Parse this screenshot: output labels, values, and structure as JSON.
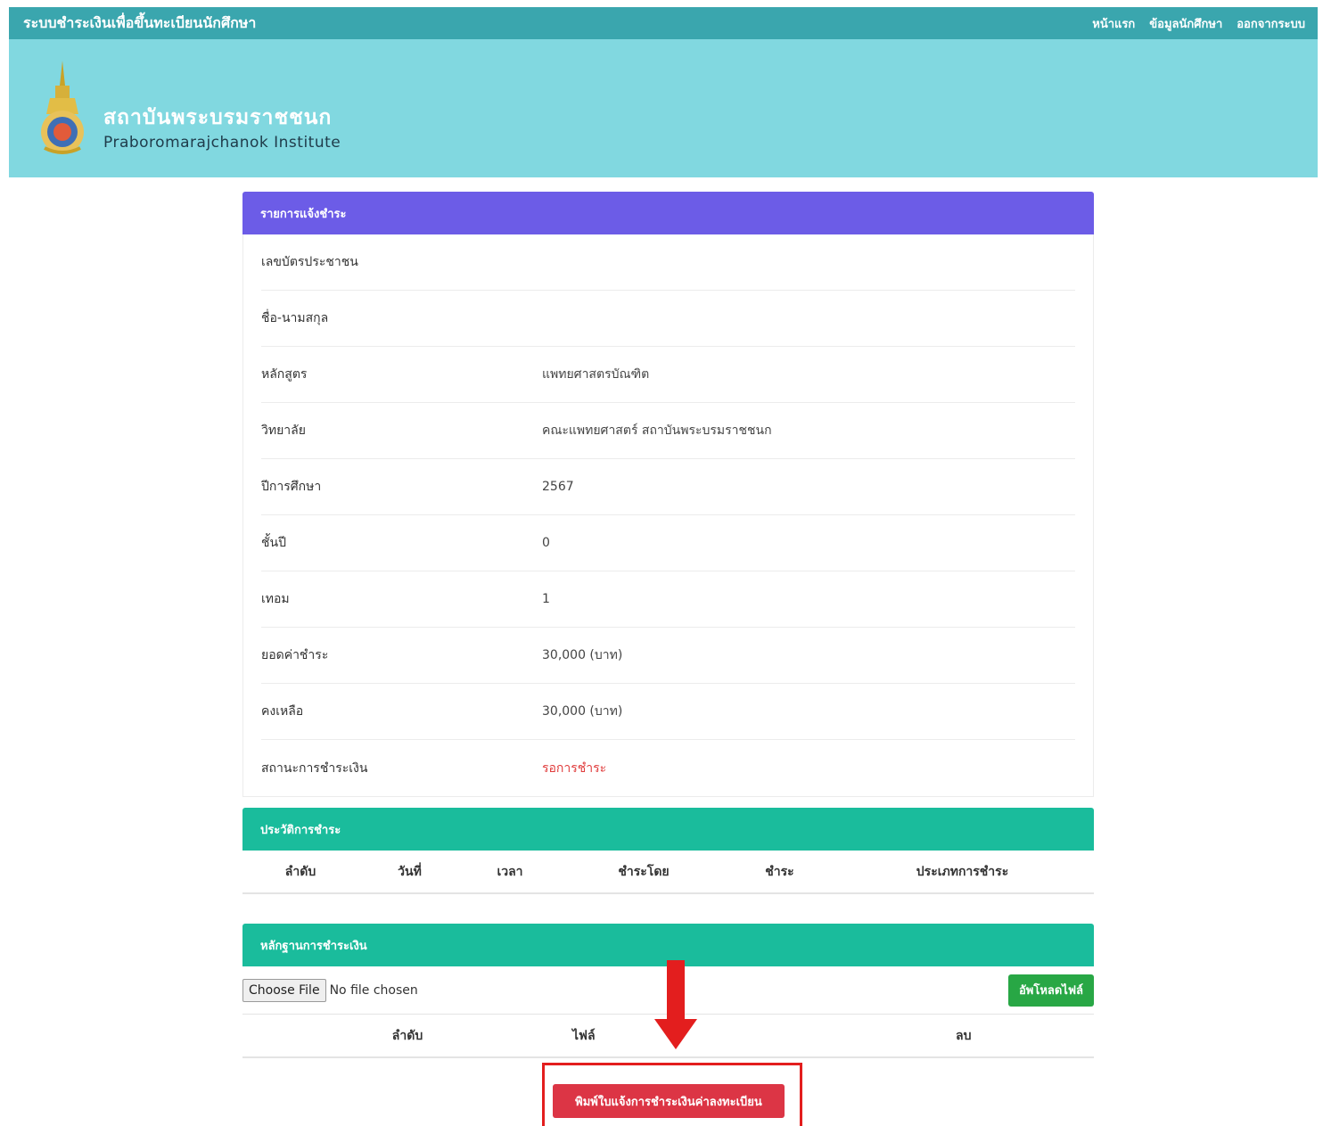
{
  "header": {
    "system_title": "ระบบชำระเงินเพื่อขึ้นทะเบียนนักศึกษา",
    "nav": [
      "หน้าแรก",
      "ข้อมูลนักศึกษา",
      "ออกจากระบบ"
    ]
  },
  "banner": {
    "institute_th": "สถาบันพระบรมราชชนก",
    "institute_en": "Praboromarajchanok Institute"
  },
  "payment_info": {
    "title": "รายการแจ้งชำระ",
    "rows": [
      {
        "label": "เลขบัตรประชาชน",
        "value": ""
      },
      {
        "label": "ชื่อ-นามสกุล",
        "value": ""
      },
      {
        "label": "หลักสูตร",
        "value": "แพทยศาสตรบัณฑิต"
      },
      {
        "label": "วิทยาลัย",
        "value": "คณะแพทยศาสตร์ สถาบันพระบรมราชชนก"
      },
      {
        "label": "ปีการศึกษา",
        "value": "2567"
      },
      {
        "label": "ชั้นปี",
        "value": "0"
      },
      {
        "label": "เทอม",
        "value": "1"
      },
      {
        "label": "ยอดค่าชำระ",
        "value": "30,000 (บาท)"
      },
      {
        "label": "คงเหลือ",
        "value": "30,000 (บาท)"
      },
      {
        "label": "สถานะการชำระเงิน",
        "value": "รอการชำระ"
      }
    ]
  },
  "history": {
    "title": "ประวัติการชำระ",
    "columns": [
      "ลำดับ",
      "วันที่",
      "เวลา",
      "ชำระโดย",
      "ชำระ",
      "ประเภทการชำระ"
    ]
  },
  "evidence": {
    "title": "หลักฐานการชำระเงิน",
    "choose_file": "Choose File",
    "no_file": "No file chosen",
    "upload_label": "อัพโหลดไฟล์",
    "columns": [
      "ลำดับ",
      "ไฟล์",
      "ลบ"
    ]
  },
  "print_button": "พิมพ์ใบแจ้งการชำระเงินค่าลงทะเบียน",
  "colors": {
    "topbar": "#3aa6ae",
    "banner": "#81d8e0",
    "purple_header": "#6c5ce7",
    "teal_header": "#1abc9c",
    "upload_button": "#28a745",
    "print_button": "#dc3545",
    "annotation": "#e31e1e"
  }
}
